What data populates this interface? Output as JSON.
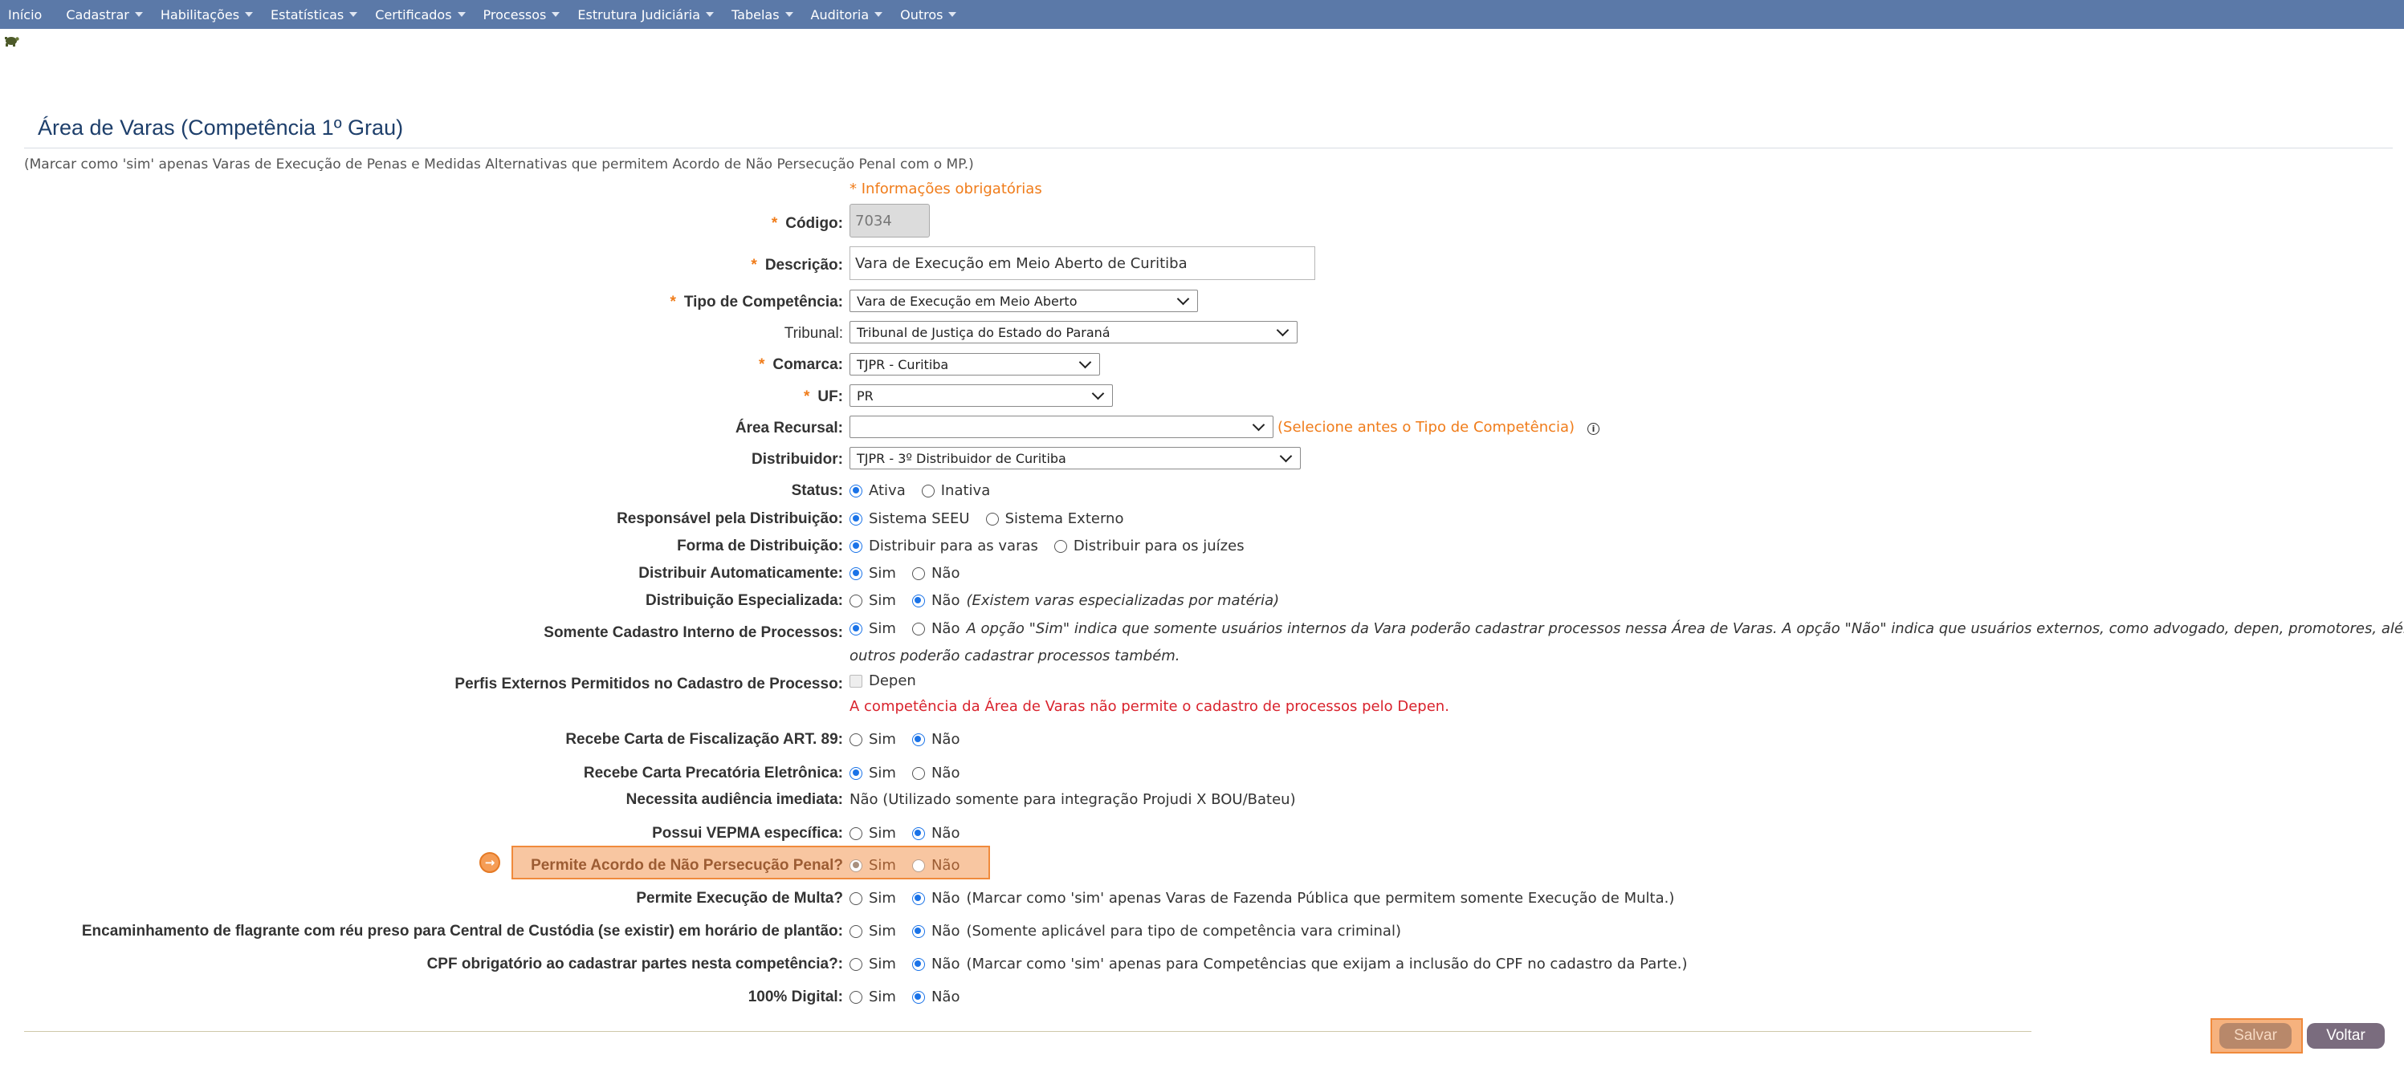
{
  "nav": {
    "items": [
      {
        "label": "Início",
        "caret": false
      },
      {
        "label": "Cadastrar",
        "caret": true
      },
      {
        "label": "Habilitações",
        "caret": true
      },
      {
        "label": "Estatísticas",
        "caret": true
      },
      {
        "label": "Certificados",
        "caret": true
      },
      {
        "label": "Processos",
        "caret": true
      },
      {
        "label": "Estrutura Judiciária",
        "caret": true
      },
      {
        "label": "Tabelas",
        "caret": true
      },
      {
        "label": "Auditoria",
        "caret": true
      },
      {
        "label": "Outros",
        "caret": true
      }
    ]
  },
  "page": {
    "title": "Área de Varas (Competência 1º Grau)",
    "note": "(Marcar como 'sim' apenas Varas de Execução de Penas e Medidas Alternativas que permitem Acordo de Não Persecução Penal com o MP.)",
    "required_note": "* Informações obrigatórias"
  },
  "form": {
    "required_mark": "*",
    "codigo": {
      "label": "Código:",
      "value": "7034"
    },
    "descricao": {
      "label": "Descrição:",
      "value": "Vara de Execução em Meio Aberto de Curitiba"
    },
    "tipo_competencia": {
      "label": "Tipo de Competência:",
      "value": "Vara de Execução em Meio Aberto"
    },
    "tribunal": {
      "label": "Tribunal:",
      "value": "Tribunal de Justiça do Estado do Paraná"
    },
    "comarca": {
      "label": "Comarca:",
      "value": "TJPR - Curitiba"
    },
    "uf": {
      "label": "UF:",
      "value": "PR"
    },
    "area_recursal": {
      "label": "Área Recursal:",
      "value": "",
      "hint": "(Selecione antes o Tipo de Competência)",
      "info_icon": "i"
    },
    "distribuidor": {
      "label": "Distribuidor:",
      "value": "TJPR - 3º Distribuidor de Curitiba"
    },
    "status": {
      "label": "Status:",
      "opt1": "Ativa",
      "opt2": "Inativa"
    },
    "responsavel": {
      "label": "Responsável pela Distribuição:",
      "opt1": "Sistema SEEU",
      "opt2": "Sistema Externo"
    },
    "forma": {
      "label": "Forma de Distribuição:",
      "opt1": "Distribuir para as varas",
      "opt2": "Distribuir para os juízes"
    },
    "distrib_auto": {
      "label": "Distribuir Automaticamente:",
      "opt1": "Sim",
      "opt2": "Não"
    },
    "distrib_esp": {
      "label": "Distribuição Especializada:",
      "opt1": "Sim",
      "opt2": "Não",
      "note": "(Existem varas especializadas por matéria)"
    },
    "cadastro_interno": {
      "label": "Somente Cadastro Interno de Processos:",
      "opt1": "Sim",
      "opt2": "Não",
      "note_line1": "A opção \"Sim\" indica que somente usuários internos da Vara poderão cadastrar processos nessa Área de Varas. A opção \"Não\" indica que usuários externos, como advogado, depen, promotores, além de",
      "note_line2": "outros poderão cadastrar processos também."
    },
    "perfis_externos": {
      "label": "Perfis Externos Permitidos no Cadastro de Processo:",
      "checkbox": "Depen",
      "warning": "A competência da Área de Varas não permite o cadastro de processos pelo Depen."
    },
    "carta_fiscalizacao": {
      "label": "Recebe Carta de Fiscalização ART. 89:",
      "opt1": "Sim",
      "opt2": "Não"
    },
    "carta_precatoria": {
      "label": "Recebe Carta Precatória Eletrônica:",
      "opt1": "Sim",
      "opt2": "Não"
    },
    "audiencia_imediata": {
      "label": "Necessita audiência imediata:",
      "value": "Não (Utilizado somente para integração Projudi X BOU/Bateu)"
    },
    "vepma": {
      "label": "Possui VEPMA específica:",
      "opt1": "Sim",
      "opt2": "Não"
    },
    "anpp": {
      "label": "Permite Acordo de Não Persecução Penal?",
      "opt1": "Sim",
      "opt2": "Não"
    },
    "multa": {
      "label": "Permite Execução de Multa?",
      "opt1": "Sim",
      "opt2": "Não",
      "note": "(Marcar como 'sim' apenas Varas de Fazenda Pública que permitem somente Execução de Multa.)"
    },
    "flagrante": {
      "label": "Encaminhamento de flagrante com réu preso para Central de Custódia (se existir) em horário de plantão:",
      "opt1": "Sim",
      "opt2": "Não",
      "note": "(Somente aplicável para tipo de competência vara criminal)"
    },
    "cpf": {
      "label": "CPF obrigatório ao cadastrar partes nesta competência?:",
      "opt1": "Sim",
      "opt2": "Não",
      "note": "(Marcar como 'sim' apenas para Competências que exijam a inclusão do CPF no cadastro da Parte.)"
    },
    "digital": {
      "label": "100% Digital:",
      "opt1": "Sim",
      "opt2": "Não"
    }
  },
  "actions": {
    "save_label": "Salvar",
    "back_label": "Voltar"
  }
}
